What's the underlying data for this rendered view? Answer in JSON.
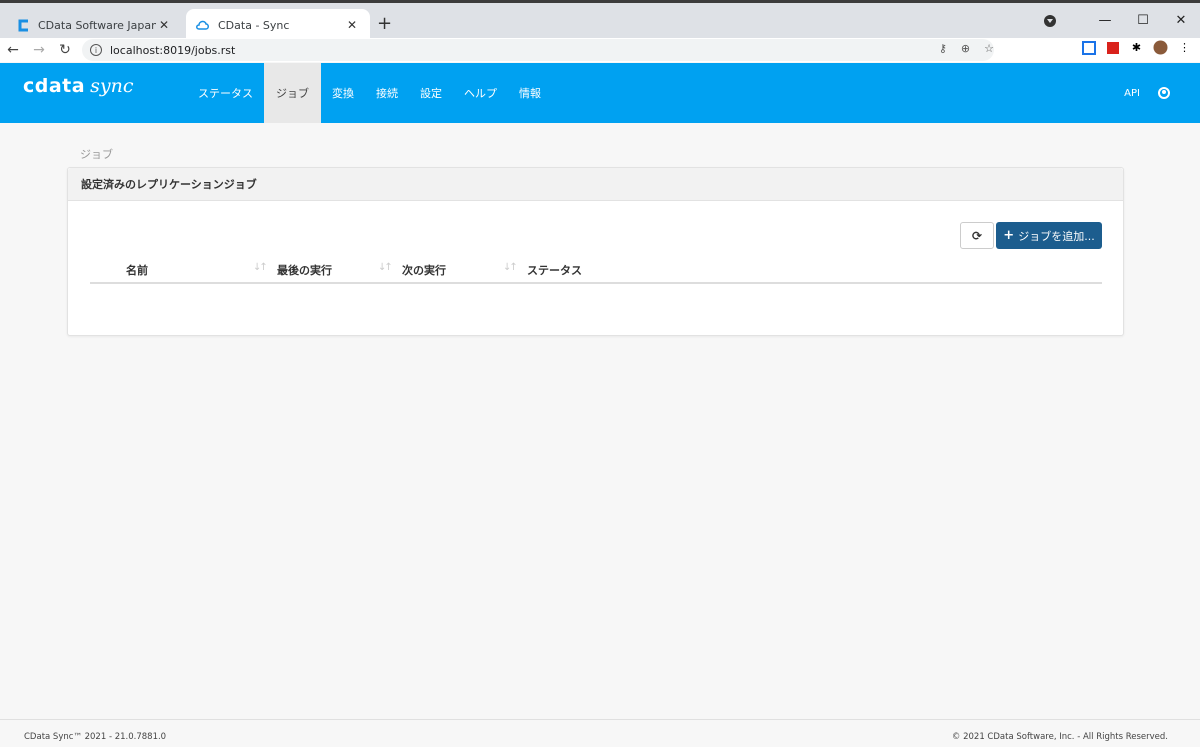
{
  "browser": {
    "tabs": [
      {
        "title": "CData Software Japan - Downloa",
        "active": false
      },
      {
        "title": "CData - Sync",
        "active": true
      }
    ],
    "new_tab": "+",
    "url": "localhost:8019/jobs.rst",
    "window_controls": {
      "minimize": "—",
      "maximize": "☐",
      "close": "✕"
    }
  },
  "app": {
    "logo_left": "cdata",
    "logo_right": "sync",
    "nav": [
      {
        "label": "ステータス",
        "active": false
      },
      {
        "label": "ジョブ",
        "active": true
      },
      {
        "label": "変換",
        "active": false
      },
      {
        "label": "接続",
        "active": false
      },
      {
        "label": "設定",
        "active": false
      },
      {
        "label": "ヘルプ",
        "active": false
      },
      {
        "label": "情報",
        "active": false
      }
    ],
    "api_label": "API",
    "accent_color": "#00a1f1"
  },
  "page": {
    "breadcrumb": "ジョブ",
    "panel_title": "設定済みのレプリケーションジョブ",
    "add_button": "ジョブを追加...",
    "columns": [
      "名前",
      "最後の実行",
      "次の実行",
      "ステータス"
    ],
    "rows": []
  },
  "footer": {
    "left": "CData Sync™ 2021 - 21.0.7881.0",
    "right": "© 2021 CData Software, Inc. - All Rights Reserved."
  }
}
